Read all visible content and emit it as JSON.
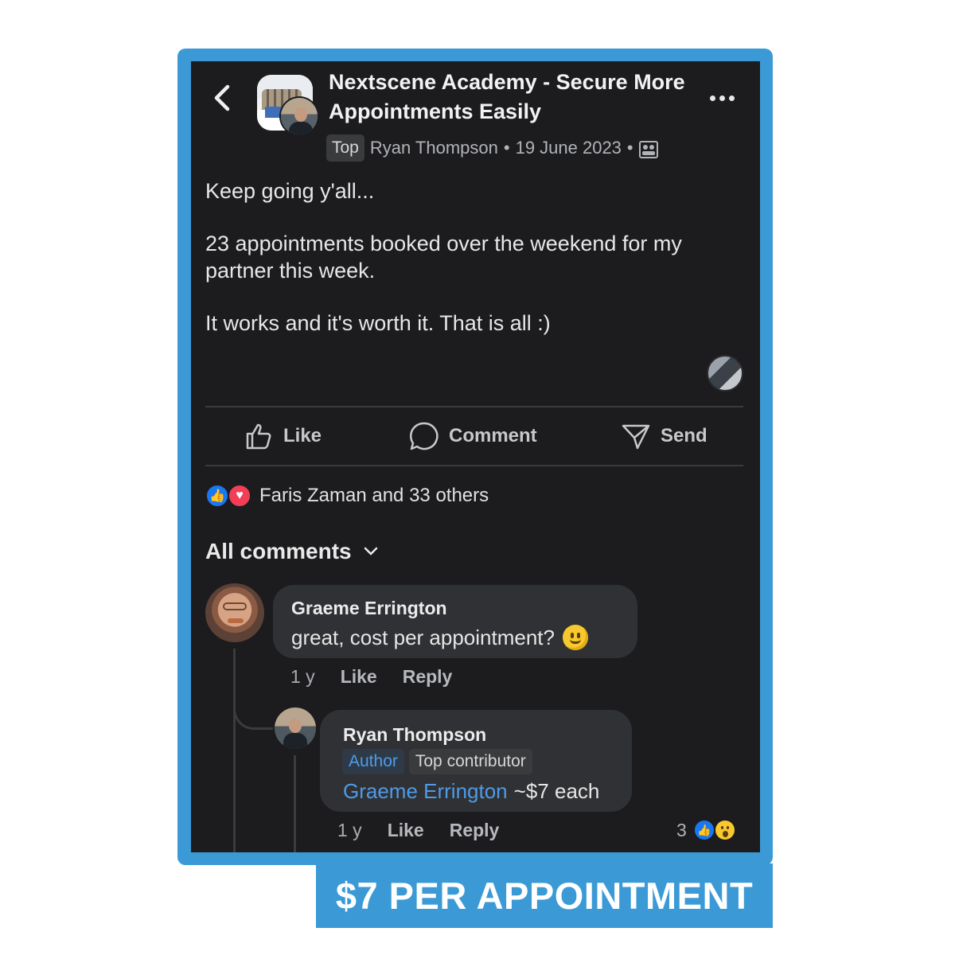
{
  "header": {
    "group_title": "Nextscene Academy - Secure More Appointments Easily",
    "top_badge": "Top",
    "author": "Ryan Thompson",
    "separator": "•",
    "date": "19 June 2023",
    "back_icon": "chevron-left-icon",
    "more_icon": "ellipsis-icon",
    "audience_icon": "group-icon"
  },
  "post": {
    "paragraphs": [
      "Keep going y'all...",
      "23 appointments booked over the weekend for my partner this week.",
      "It works and it's worth it. That is all :)"
    ]
  },
  "actions": {
    "like": "Like",
    "comment": "Comment",
    "send": "Send"
  },
  "reactions": {
    "summary": "Faris Zaman and 33 others",
    "icons": [
      "like-icon",
      "heart-icon"
    ]
  },
  "comments_header": {
    "label": "All comments"
  },
  "comments": [
    {
      "author": "Graeme Errington",
      "text": "great, cost per appointment?",
      "emoji": "smiley-emoji",
      "time": "1 y",
      "like": "Like",
      "reply": "Reply"
    },
    {
      "author": "Ryan Thompson",
      "tags": [
        "Author",
        "Top contributor"
      ],
      "mention": "Graeme Errington",
      "text": "~$7 each",
      "time": "1 y",
      "like": "Like",
      "reply": "Reply",
      "reaction_count": "3"
    }
  ],
  "banner": {
    "text": "$7 PER APPOINTMENT"
  },
  "colors": {
    "frame": "#3b9ad6",
    "screen_bg": "#1c1c1e",
    "bubble_bg": "#303134",
    "link": "#4e9be8"
  }
}
